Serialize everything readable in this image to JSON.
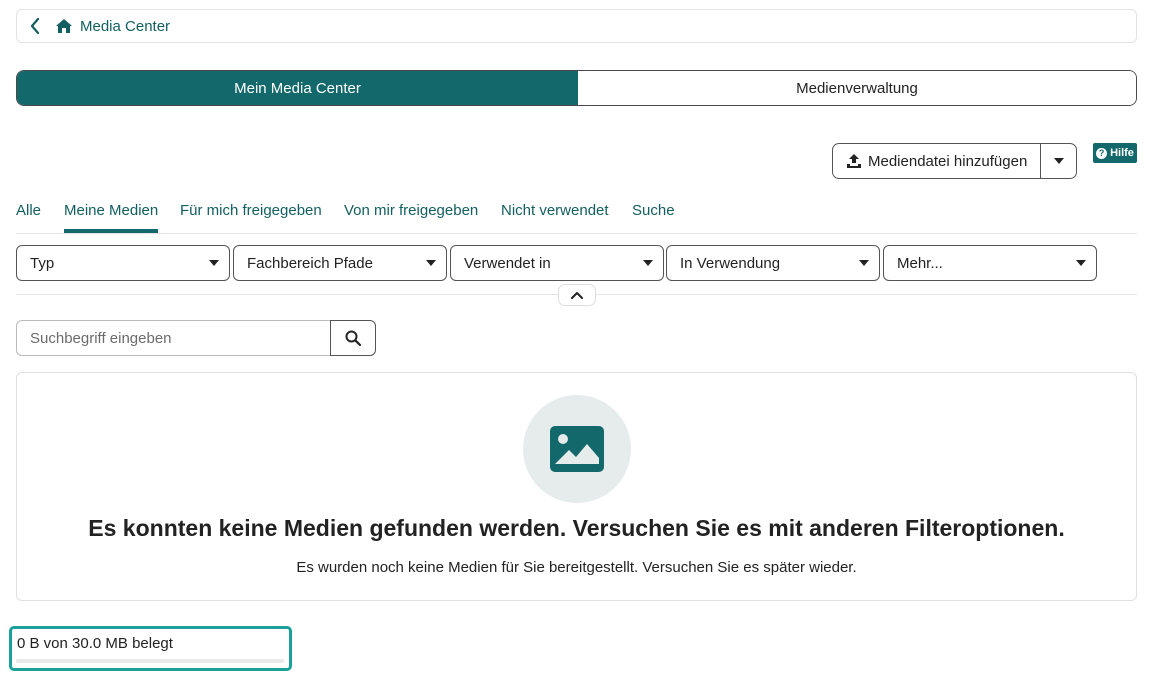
{
  "breadcrumb": {
    "title": "Media Center"
  },
  "view_switch": {
    "active": "Mein Media Center",
    "other": "Medienverwaltung"
  },
  "actions": {
    "add_label": "Mediendatei hinzufügen",
    "help_label": "Hilfe"
  },
  "tabs": [
    {
      "label": "Alle"
    },
    {
      "label": "Meine Medien"
    },
    {
      "label": "Für mich freigegeben"
    },
    {
      "label": "Von mir freigegeben"
    },
    {
      "label": "Nicht verwendet"
    },
    {
      "label": "Suche"
    }
  ],
  "active_tab": "Meine Medien",
  "filters": [
    {
      "label": "Typ"
    },
    {
      "label": "Fachbereich Pfade"
    },
    {
      "label": "Verwendet in"
    },
    {
      "label": "In Verwendung"
    },
    {
      "label": "Mehr..."
    }
  ],
  "search": {
    "placeholder": "Suchbegriff eingeben"
  },
  "empty_state": {
    "title": "Es konnten keine Medien gefunden werden. Versuchen Sie es mit anderen Filteroptionen.",
    "subtitle": "Es wurden noch keine Medien für Sie bereitgestellt. Versuchen Sie es später wieder."
  },
  "quota": {
    "text": "0 B von 30.0 MB belegt",
    "fraction_used": 0
  },
  "colors": {
    "accent": "#12686a",
    "highlight": "#1aa19b",
    "empty_circle": "#e6eceb"
  },
  "icons": [
    "chevron-left-icon",
    "home-icon",
    "upload-icon",
    "caret-down-icon",
    "help-icon",
    "chevron-up-icon",
    "search-icon",
    "image-icon"
  ]
}
